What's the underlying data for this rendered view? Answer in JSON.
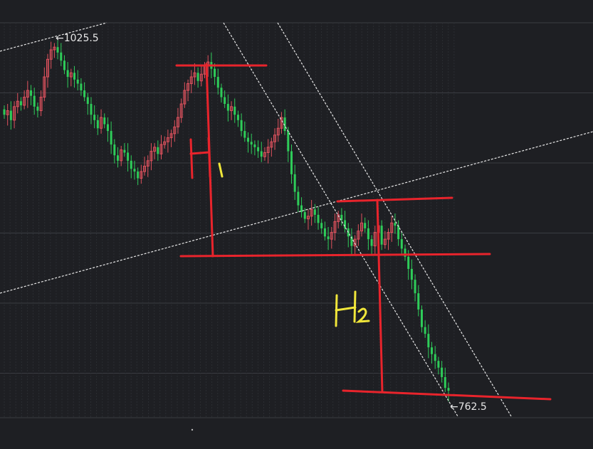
{
  "colors": {
    "background": "#1e1f23",
    "grid_major": "#3a3c42",
    "grid_minor": "#2b2d32",
    "up": "#e0525e",
    "down": "#2ecc59",
    "trendline": "#e8e8e8",
    "annotation_red": "#e8242c",
    "annotation_yellow": "#f0e63a",
    "label_text": "#e6e6e6"
  },
  "chart_data": {
    "type": "candlestick",
    "title": "",
    "xlabel": "",
    "ylabel": "",
    "ylim": [
      748,
      1040
    ],
    "high_marker": {
      "label": "←1025.5",
      "value": 1025.5
    },
    "low_marker": {
      "label": "←762.5",
      "value": 762.5
    },
    "closes": [
      972,
      975,
      968,
      978,
      982,
      979,
      985,
      990,
      986,
      978,
      975,
      985,
      1000,
      1013,
      1020,
      1022,
      1018,
      1012,
      1005,
      1000,
      1003,
      998,
      995,
      990,
      985,
      980,
      972,
      968,
      962,
      970,
      965,
      960,
      950,
      942,
      938,
      946,
      944,
      938,
      932,
      930,
      925,
      930,
      934,
      938,
      945,
      948,
      943,
      950,
      952,
      955,
      958,
      963,
      970,
      980,
      990,
      995,
      1000,
      1003,
      997,
      1002,
      1008,
      1011,
      1006,
      1000,
      992,
      985,
      980,
      975,
      978,
      972,
      968,
      960,
      955,
      952,
      950,
      948,
      945,
      941,
      944,
      948,
      952,
      957,
      962,
      970,
      960,
      945,
      928,
      915,
      905,
      900,
      895,
      897,
      902,
      898,
      892,
      888,
      882,
      880,
      885,
      893,
      898,
      894,
      888,
      882,
      875,
      880,
      886,
      892,
      888,
      880,
      875,
      885,
      890,
      876,
      880,
      885,
      892,
      890,
      880,
      873,
      867,
      858,
      850,
      840,
      828,
      815,
      810,
      800,
      795,
      790,
      785,
      778,
      770,
      768
    ],
    "annotations": [
      "H",
      "1",
      "H",
      "2"
    ]
  }
}
